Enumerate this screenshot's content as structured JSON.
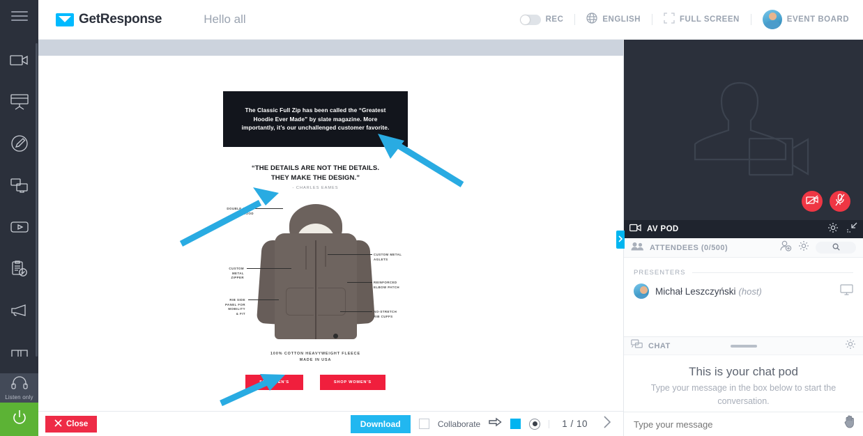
{
  "rail": {
    "menu_icon": "hamburger-menu-icon",
    "items": [
      {
        "name": "webcam",
        "icon": "video-camera-icon"
      },
      {
        "name": "presentation",
        "icon": "whiteboard-screen-icon"
      },
      {
        "name": "whiteboard",
        "icon": "pencil-circle-icon"
      },
      {
        "name": "screen-share",
        "icon": "screen-share-icon"
      },
      {
        "name": "youtube",
        "icon": "play-video-icon"
      },
      {
        "name": "polls",
        "icon": "clipboard-check-icon"
      },
      {
        "name": "call-to-action",
        "icon": "megaphone-icon"
      },
      {
        "name": "device",
        "icon": "headset-stand-icon"
      }
    ],
    "listen_only_label": "Listen only",
    "listen_only_icon": "headphones-icon",
    "power_icon": "power-icon"
  },
  "header": {
    "brand_name": "GetResponse",
    "brand_icon": "envelope-icon",
    "room_title": "Hello all",
    "rec_label": "REC",
    "rec_toggle_state": "off",
    "language_label": "ENGLISH",
    "language_icon": "globe-icon",
    "fullscreen_label": "FULL SCREEN",
    "fullscreen_icon": "expand-icon",
    "event_board_label": "EVENT BOARD",
    "avatar_name": "user-avatar"
  },
  "slide": {
    "callout": "The Classic Full Zip has been called the “Greatest Hoodie Ever Made” by slate magazine. More importantly, it’s our unchallenged customer favorite.",
    "quote_line1": "“THE DETAILS ARE NOT THE DETAILS.",
    "quote_line2": "THEY MAKE THE DESIGN.”",
    "quote_author": "- CHARLES EAMES",
    "annotations": [
      {
        "id": "double-lined-hood",
        "text": "DOUBLE-LINED\nHOOD"
      },
      {
        "id": "custom-metal-aglets",
        "text": "CUSTOM METAL\nAGLETS"
      },
      {
        "id": "custom-metal-zipper",
        "text": "CUSTOM\nMETAL\nZIPPER"
      },
      {
        "id": "reinforced-elbow-patch",
        "text": "REINFORCED\nELBOW PATCH"
      },
      {
        "id": "rib-side-panel",
        "text": "RIB SIDE\nPANEL FOR\nMOBILITY\n& FIT"
      },
      {
        "id": "no-stretch-rib-cuffs",
        "text": "NO-STRETCH\nRIB CUFFS"
      }
    ],
    "material_line1": "100% COTTON HEAVYWEIGHT FLEECE",
    "material_line2": "MADE IN USA",
    "cta_men": "SHOP MEN'S",
    "cta_women": "SHOP WOMEN'S",
    "arrow_color": "#29ABE2"
  },
  "toolbar": {
    "close_label": "Close",
    "close_icon": "x-icon",
    "download_label": "Download",
    "collaborate_label": "Collaborate",
    "collaborate_checked": false,
    "pointer_icon": "arrow-right-icon",
    "color_swatch": "#00b4f0",
    "brush_icon": "dot-brush-icon",
    "page_indicator": "1 / 10",
    "next_icon": "chevron-right-icon"
  },
  "right_panel": {
    "avpod": {
      "title": "AV POD",
      "title_icon": "video-camera-icon",
      "settings_icon": "gear-icon",
      "minimize_icon": "minimize-icon",
      "placeholder_icon": "person-video-placeholder-icon",
      "camera_button_icon": "camera-off-icon",
      "mic_button_icon": "mic-off-icon",
      "button_color": "#ef3644"
    },
    "collapse_tab_icon": "chevron-right-icon",
    "attendees": {
      "label": "ATTENDEES (0/500)",
      "icon": "people-icon",
      "invite_icon": "add-person-icon",
      "settings_icon": "gear-icon",
      "search_icon": "search-icon"
    },
    "presenters": {
      "section_label": "PRESENTERS",
      "rows": [
        {
          "name": "Michał Leszczyński",
          "role": "(host)",
          "device_icon": "monitor-icon"
        }
      ]
    },
    "chat": {
      "title": "CHAT",
      "title_icon": "chat-bubble-icon",
      "settings_icon": "gear-icon",
      "empty_heading": "This is your chat pod",
      "empty_sub": "Type your message in the box below to start the conversation.",
      "input_placeholder": "Type your message",
      "cursor_icon": "hand-cursor-icon"
    }
  }
}
